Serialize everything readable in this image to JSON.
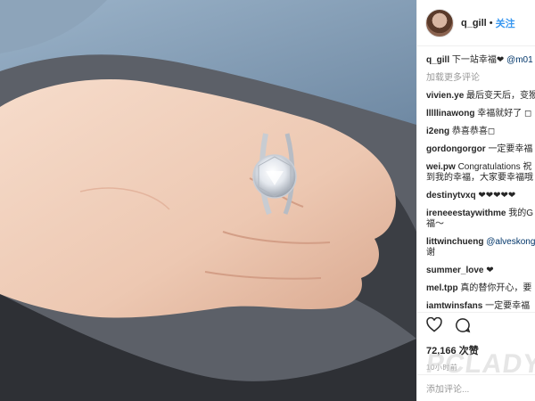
{
  "post": {
    "username": "q_gill",
    "follow_label": "关注",
    "separator": "•"
  },
  "caption": {
    "username": "q_gill",
    "text": "下一站幸福❤",
    "mention": "@m01"
  },
  "load_more_label": "加载更多评论",
  "comments": [
    {
      "user": "vivien.ye",
      "text": "最后变天后，变猴"
    },
    {
      "user": "lllllinawong",
      "text": "幸福就好了 ◻"
    },
    {
      "user": "i2eng",
      "text": "恭喜恭喜◻"
    },
    {
      "user": "gordongorgor",
      "text": "一定要幸福"
    },
    {
      "user": "wei.pw",
      "text": "Congratulations 祝",
      "text2": "到我的幸福，大家要幸福哦"
    },
    {
      "user": "destinytvxq",
      "text": "❤❤❤❤❤"
    },
    {
      "user": "ireneeestaywithme",
      "text": "我的G",
      "text2": "福～"
    },
    {
      "user": "littwinchueng",
      "mention": "@alveskong",
      "text2": "谢"
    },
    {
      "user": "summer_love",
      "text": "❤"
    },
    {
      "user": "mel.tpp",
      "text": "真的替你开心，要"
    },
    {
      "user": "iamtwinsfans",
      "text": "一定要幸福"
    }
  ],
  "likes": "72,166 次赞",
  "date": "10小时前",
  "add_comment_placeholder": "添加评论...",
  "watermark": "PCLADY",
  "icons": {
    "like": "heart-icon",
    "comment": "comment-bubble-icon"
  },
  "colors": {
    "link": "#3897f0",
    "text": "#262626",
    "muted": "#999999"
  }
}
